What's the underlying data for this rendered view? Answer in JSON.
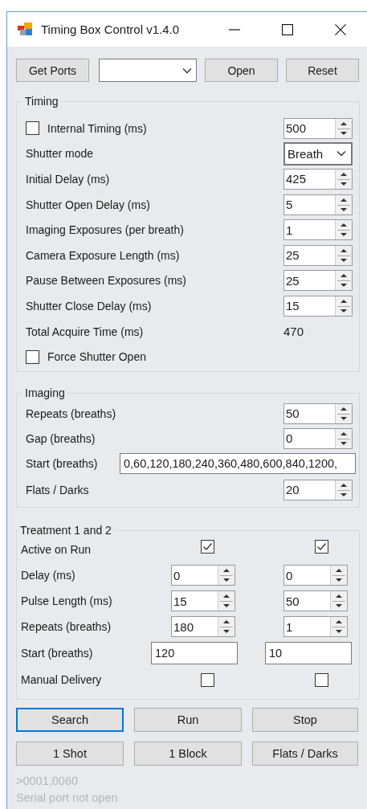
{
  "window": {
    "title": "Timing Box Control v1.4.0"
  },
  "top_bar": [
    {
      "kind": "button",
      "label": "Get Ports"
    },
    {
      "kind": "dropdown"
    },
    {
      "kind": "button",
      "label": "Open"
    },
    {
      "kind": "button",
      "label": "Reset"
    }
  ],
  "timing": {
    "title": "Timing",
    "rows": [
      {
        "kind": "check-spin",
        "label": "Internal Timing (ms)",
        "checked": false,
        "value": "500"
      },
      {
        "kind": "combo",
        "label": "Shutter mode",
        "value": "Breath"
      },
      {
        "kind": "spin",
        "label": "Initial Delay (ms)",
        "value": "425"
      },
      {
        "kind": "spin",
        "label": "Shutter Open Delay (ms)",
        "value": "5"
      },
      {
        "kind": "spin",
        "label": "Imaging Exposures (per breath)",
        "value": "1"
      },
      {
        "kind": "spin",
        "label": "Camera Exposure Length (ms)",
        "value": "25"
      },
      {
        "kind": "spin",
        "label": "Pause Between Exposures (ms)",
        "value": "25"
      },
      {
        "kind": "spin",
        "label": "Shutter Close Delay (ms)",
        "value": "15"
      },
      {
        "kind": "readout",
        "label": "Total Acquire Time (ms)",
        "value": "470"
      },
      {
        "kind": "check",
        "label": "Force Shutter Open",
        "checked": false
      }
    ]
  },
  "imaging": {
    "title": "Imaging",
    "rows": [
      {
        "kind": "spin",
        "label": "Repeats (breaths)",
        "value": "50"
      },
      {
        "kind": "spin",
        "label": "Gap (breaths)",
        "value": "0"
      },
      {
        "kind": "text",
        "label": "Start (breaths)",
        "value": "0,60,120,180,240,360,480,600,840,1200,"
      },
      {
        "kind": "spin",
        "label": "Flats / Darks",
        "value": "20"
      }
    ]
  },
  "treatment": {
    "title": "Treatment 1 and 2",
    "rows": [
      {
        "kind": "check",
        "label": "Active on Run",
        "cells": [
          {
            "checked": true
          },
          {
            "checked": true
          }
        ]
      },
      {
        "kind": "spin",
        "label": "Delay (ms)",
        "cells": [
          {
            "value": "0"
          },
          {
            "value": "0"
          }
        ]
      },
      {
        "kind": "spin",
        "label": "Pulse Length (ms)",
        "cells": [
          {
            "value": "15"
          },
          {
            "value": "50"
          }
        ]
      },
      {
        "kind": "spin",
        "label": "Repeats (breaths)",
        "cells": [
          {
            "value": "180"
          },
          {
            "value": "1"
          }
        ]
      },
      {
        "kind": "text",
        "label": "Start (breaths)",
        "cells": [
          {
            "value": "120"
          },
          {
            "value": "10"
          }
        ]
      },
      {
        "kind": "check",
        "label": "Manual Delivery",
        "cells": [
          {
            "checked": false
          },
          {
            "checked": false
          }
        ]
      }
    ]
  },
  "buttons": [
    {
      "label": "Search",
      "focused": true
    },
    {
      "label": "Run",
      "focused": false
    },
    {
      "label": "Stop",
      "focused": false
    },
    {
      "label": "1 Shot",
      "focused": false
    },
    {
      "label": "1 Block",
      "focused": false
    },
    {
      "label": "Flats / Darks",
      "focused": false
    }
  ],
  "status_lines": [
    ">0001,0060",
    "Serial port not open"
  ]
}
